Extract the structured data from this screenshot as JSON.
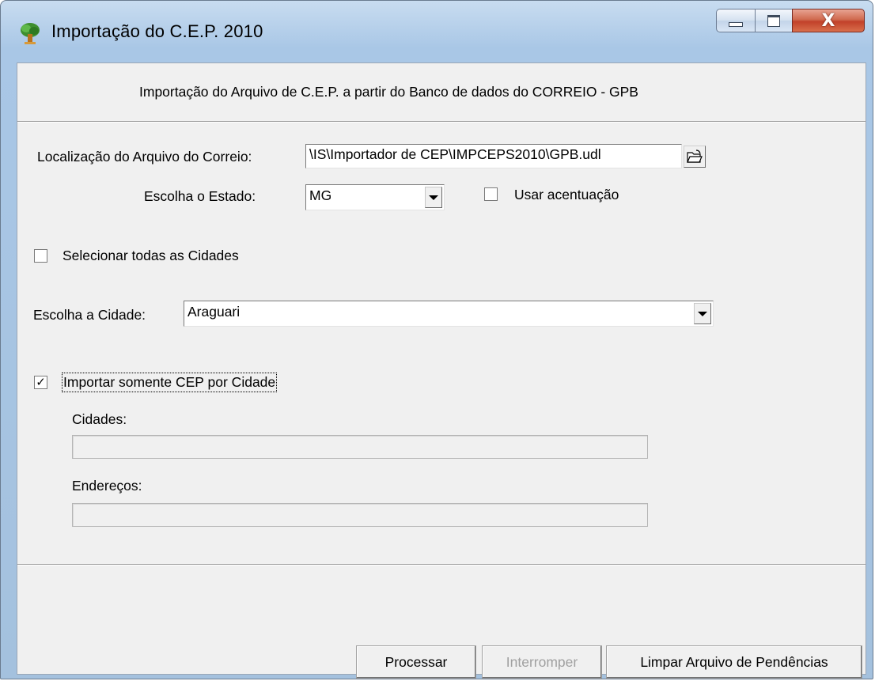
{
  "window": {
    "title": "Importação do C.E.P. 2010",
    "close_glyph": "X"
  },
  "header": {
    "description": "Importação do Arquivo de C.E.P.  a partir do Banco de dados do CORREIO - GPB"
  },
  "form": {
    "file_label": "Localização do Arquivo do Correio:",
    "file_value": "\\IS\\Importador de CEP\\IMPCEPS2010\\GPB.udl",
    "state_label": "Escolha o Estado:",
    "state_value": "MG",
    "accent_label": "Usar acentuação",
    "accent_checked": false,
    "select_all_label": "Selecionar todas as Cidades",
    "select_all_checked": false,
    "city_label": "Escolha a Cidade:",
    "city_value": "Araguari",
    "only_city_label": "Importar somente CEP por Cidade",
    "only_city_checked": true,
    "only_city_mark": "✓",
    "cities_progress_label": "Cidades:",
    "cities_progress": 0,
    "addresses_progress_label": "Endereços:",
    "addresses_progress": 0
  },
  "buttons": {
    "process": "Processar",
    "interrupt": "Interromper",
    "clear_pending": "Limpar Arquivo de Pendências"
  },
  "icons": {
    "app": "tree-icon",
    "browse": "folder-open-icon",
    "minimize": "minimize-icon",
    "maximize": "maximize-icon",
    "close": "close-icon"
  }
}
